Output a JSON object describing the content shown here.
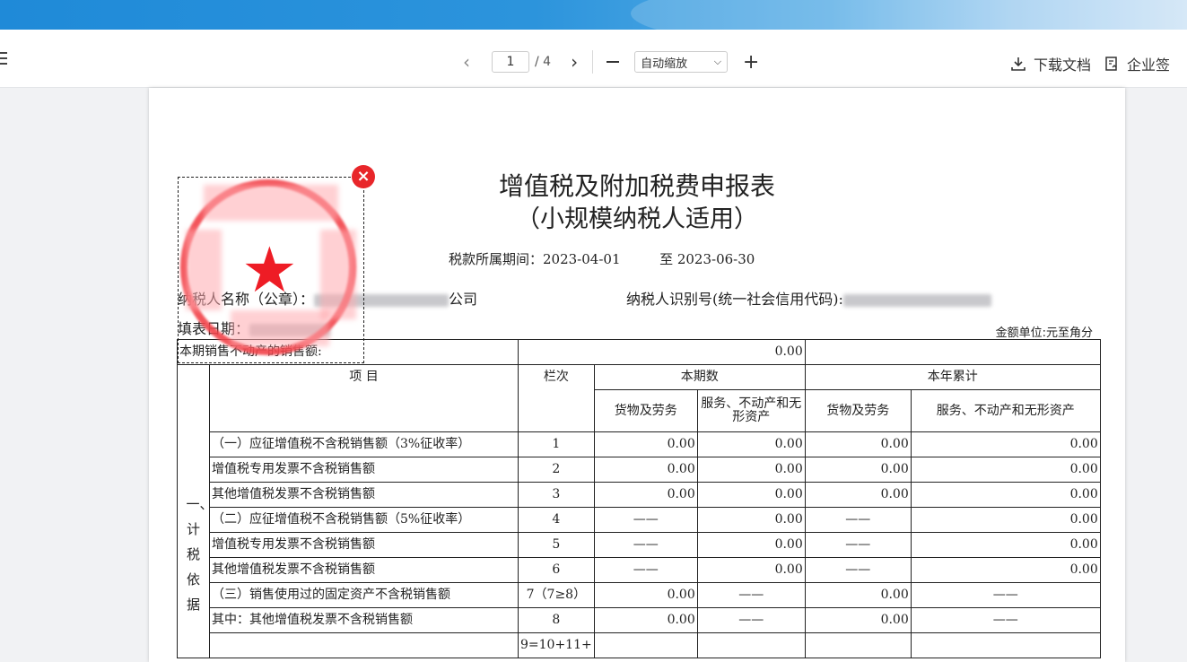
{
  "toolbar": {
    "prev_icon": "chevron-left-icon",
    "page_current": "1",
    "page_total": "/ 4",
    "next_icon": "chevron-right-icon",
    "zoom_selected": "自动缩放",
    "download_label": "下载文档",
    "enterprise_sign_label": "企业签"
  },
  "document": {
    "title": "增值税及附加税费申报表",
    "subtitle": "（小规模纳税人适用）",
    "period_label": "税款所属期间：2023-04-01",
    "period_to": "至  2023-06-30",
    "taxpayer_label": "纳税人名称（公章）：",
    "taxpayer_suffix": "公司",
    "taxid_label": "纳税人识别号(统一社会信用代码):",
    "fill_date_label": "填表日期：",
    "unit_label": "金额单位:元至角分",
    "table": {
      "row0_label": "本期销售不动产的销售额:",
      "row0_value": "0.00",
      "side_label": "一、计税依据",
      "header_item": "项    目",
      "header_col": "栏次",
      "header_current": "本期数",
      "header_ytd": "本年累计",
      "sub_goods": "货物及劳务",
      "sub_services_short": "服务、不动产和无形资产",
      "sub_goods2": "货物及劳务",
      "sub_services_long": "服务、不动产和无形资产",
      "rows": [
        {
          "item": "（一）应征增值税不含税销售额（3%征收率）",
          "col": "1",
          "v1": "0.00",
          "v2": "0.00",
          "v3": "0.00",
          "v4": "0.00"
        },
        {
          "item": "增值税专用发票不含税销售额",
          "col": "2",
          "v1": "0.00",
          "v2": "0.00",
          "v3": "0.00",
          "v4": "0.00"
        },
        {
          "item": "其他增值税发票不含税销售额",
          "col": "3",
          "v1": "0.00",
          "v2": "0.00",
          "v3": "0.00",
          "v4": "0.00"
        },
        {
          "item": "（二）应征增值税不含税销售额（5%征收率）",
          "col": "4",
          "v1": "——",
          "v2": "0.00",
          "v3": "——",
          "v4": "0.00"
        },
        {
          "item": "增值税专用发票不含税销售额",
          "col": "5",
          "v1": "——",
          "v2": "0.00",
          "v3": "——",
          "v4": "0.00"
        },
        {
          "item": "其他增值税发票不含税销售额",
          "col": "6",
          "v1": "——",
          "v2": "0.00",
          "v3": "——",
          "v4": "0.00"
        },
        {
          "item": "（三）销售使用过的固定资产不含税销售额",
          "col": "7（7≥8）",
          "v1": "0.00",
          "v2": "——",
          "v3": "0.00",
          "v4": "——"
        },
        {
          "item": "其中：其他增值税发票不含税销售额",
          "col": "8",
          "v1": "0.00",
          "v2": "——",
          "v3": "0.00",
          "v4": "——"
        },
        {
          "item": "",
          "col": "9=10+11+",
          "v1": "",
          "v2": "",
          "v3": "",
          "v4": ""
        }
      ]
    }
  },
  "colors": {
    "accent_blue": "#1f8ad8",
    "stamp_red": "#ee1c25"
  }
}
